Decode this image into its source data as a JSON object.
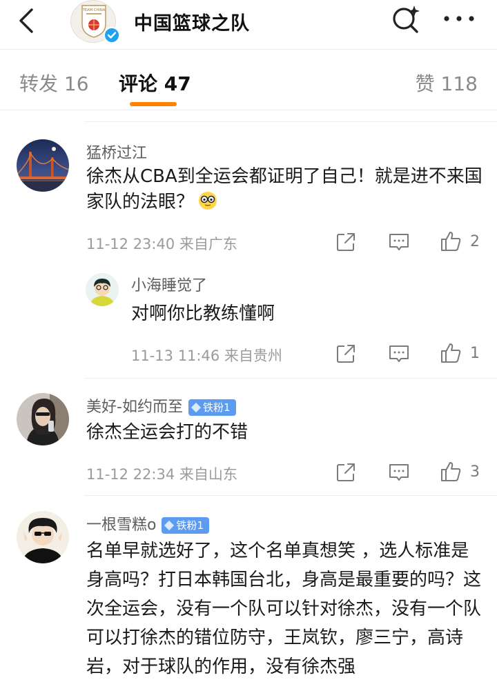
{
  "header": {
    "title": "中国篮球之队",
    "logo_text": "TEAM CHINA"
  },
  "tabs": {
    "repost": "转发 16",
    "comments": "评论 47",
    "likes": "赞 118"
  },
  "colors": {
    "accent": "#ff8200",
    "badge": "#5b9bf0",
    "verified": "#1da1f2"
  },
  "comments": [
    {
      "user": "猛桥过江",
      "text": "徐杰从CBA到全运会都证明了自己！就是进不来国家队的法眼？",
      "time": "11-12 23:40",
      "location": "来自广东",
      "likes": "2",
      "reply": {
        "user": "小海睡觉了",
        "text": "对啊你比教练懂啊",
        "time": "11-13 11:46",
        "location": "来自贵州",
        "likes": "1"
      }
    },
    {
      "user": "美好-如约而至",
      "badge": "铁粉1",
      "text": "徐杰全运会打的不错",
      "time": "11-12 22:34",
      "location": "来自山东",
      "likes": "3"
    },
    {
      "user": "一根雪糕o",
      "badge": "铁粉1",
      "text": "名单早就选好了，这个名单真想笑 ，选人标准是身高吗？打日本韩国台北，身高是最重要的吗？这次全运会，没有一个队可以针对徐杰，没有一个队可以打徐杰的错位防守，王岚钦，廖三宁，高诗岩，对于球队的作用，没有徐杰强"
    }
  ]
}
